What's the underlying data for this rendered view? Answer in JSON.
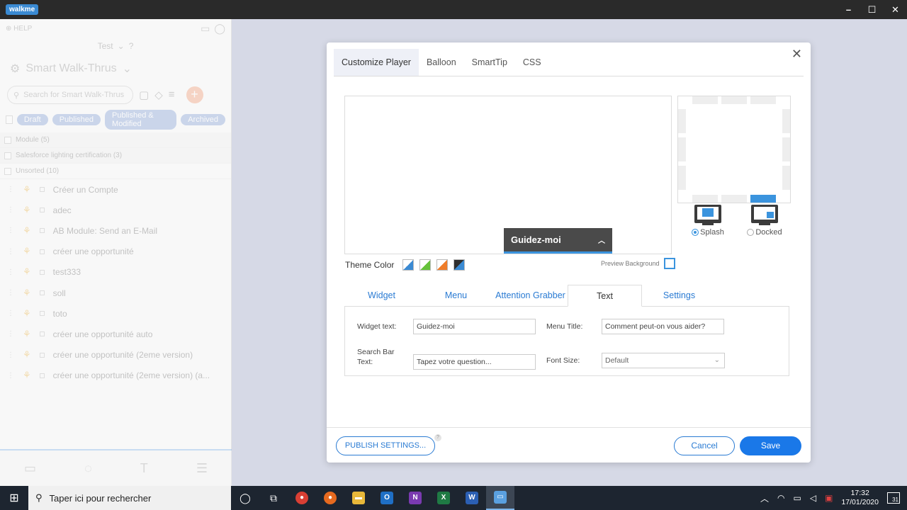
{
  "titlebar": {
    "logo": "walkme",
    "minimize": "–",
    "maximize": "☐",
    "close": "✕"
  },
  "left_panel": {
    "help": "HELP",
    "env": "Test",
    "title": "Smart Walk-Thrus",
    "search_placeholder": "Search for Smart Walk-Thrus",
    "filters": [
      "Draft",
      "Published",
      "Published & Modified",
      "Archived"
    ],
    "groups": [
      "Module (5)",
      "Salesforce lighting certification (3)",
      "Unsorted (10)"
    ],
    "items": [
      "Créer un Compte",
      "adec",
      "AB Module: Send an E-Mail",
      "créer une opportunité",
      "test333",
      "soll",
      "toto",
      "créer une opportunité auto",
      "créer une opportunité (2eme version)",
      "créer une opportunité (2eme version) (a..."
    ]
  },
  "modal": {
    "tabs": [
      "Customize Player",
      "Balloon",
      "SmartTip",
      "CSS"
    ],
    "close": "✕",
    "widget_label": "Guidez-moi",
    "theme_color_label": "Theme Color",
    "preview_background_label": "Preview Background",
    "modes": {
      "splash": "Splash",
      "docked": "Docked"
    },
    "sub_tabs": [
      "Widget",
      "Menu",
      "Attention Grabber",
      "Text",
      "Settings"
    ],
    "fields": {
      "widget_text_label": "Widget text:",
      "widget_text_value": "Guidez-moi",
      "menu_title_label": "Menu Title:",
      "menu_title_value": "Comment peut-on vous aider?",
      "search_bar_label_1": "Search Bar",
      "search_bar_label_2": "Text:",
      "search_bar_value": "Tapez votre question...",
      "font_size_label": "Font Size:",
      "font_size_value": "Default"
    },
    "footer": {
      "publish": "PUBLISH SETTINGS...",
      "cancel": "Cancel",
      "save": "Save"
    }
  },
  "taskbar": {
    "search_placeholder": "Taper ici pour rechercher",
    "time": "17:32",
    "date": "17/01/2020",
    "notifications": "31"
  },
  "colors": {
    "accent": "#1a78e8",
    "widget_bg": "#4a4a4a",
    "picker_selected": "#3b94de"
  }
}
